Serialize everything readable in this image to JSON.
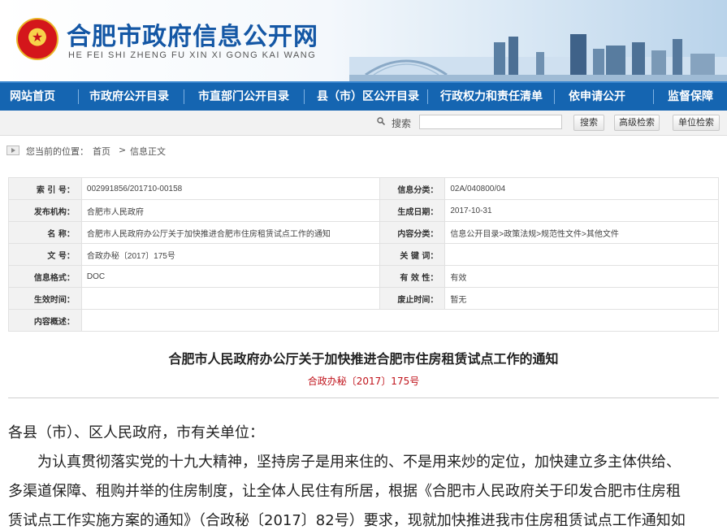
{
  "header": {
    "emblem_text": "★",
    "site_title": "合肥市政府信息公开网",
    "site_subtitle": "HE FEI SHI ZHENG FU XIN XI GONG KAI WANG"
  },
  "nav": {
    "items": [
      "网站首页",
      "市政府公开目录",
      "市直部门公开目录",
      "县（市）区公开目录",
      "行政权力和责任清单",
      "依申请公开",
      "监督保障"
    ]
  },
  "search": {
    "label": "搜索",
    "placeholder": "",
    "search_button": "搜索",
    "advanced_button": "高级检索",
    "unit_button": "单位检索"
  },
  "breadcrumb": {
    "prefix": "您当前的位置：",
    "home": "首页",
    "sep": ">",
    "current": "信息正文"
  },
  "meta": {
    "index_no_label": "索 引 号：",
    "index_no": "002991856/201710-00158",
    "category_label": "信息分类：",
    "category": "02A/040800/04",
    "publisher_label": "发布机构：",
    "publisher": "合肥市人民政府",
    "date_label": "生成日期：",
    "date": "2017-10-31",
    "name_label": "名 称：",
    "name": "合肥市人民政府办公厅关于加快推进合肥市住房租赁试点工作的通知",
    "content_cat_label": "内容分类：",
    "content_cat": "信息公开目录>政策法规>规范性文件>其他文件",
    "docno_label": "文 号：",
    "docno": "合政办秘〔2017〕175号",
    "keywords_label": "关 键 词：",
    "keywords": "",
    "format_label": "信息格式：",
    "format": "DOC",
    "validity_label": "有 效 性：",
    "validity": "有效",
    "effective_label": "生效时间：",
    "effective": "",
    "expiry_label": "废止时间：",
    "expiry": "暂无",
    "summary_label": "内容概述：",
    "summary": ""
  },
  "document": {
    "title": "合肥市人民政府办公厅关于加快推进合肥市住房租赁试点工作的通知",
    "number": "合政办秘〔2017〕175号",
    "salutation": "各县（市）、区人民政府，市有关单位：",
    "para_line1": "为认真贯彻落实党的十九大精神，坚持房子是用来住的、不是用来炒的定位，加快建立多主体供给、",
    "para_line2": "多渠道保障、租购并举的住房制度，让全体人民住有所居，根据《合肥市人民政府关于印发合肥市住房租",
    "para_line3": "赁试点工作实施方案的通知》（合政秘〔2017〕82号）要求，现就加快推进我市住房租赁试点工作通知如"
  },
  "colors": {
    "nav_bg": "#1565b1",
    "title_blue": "#1457a5",
    "doc_no_red": "#c0141c"
  }
}
